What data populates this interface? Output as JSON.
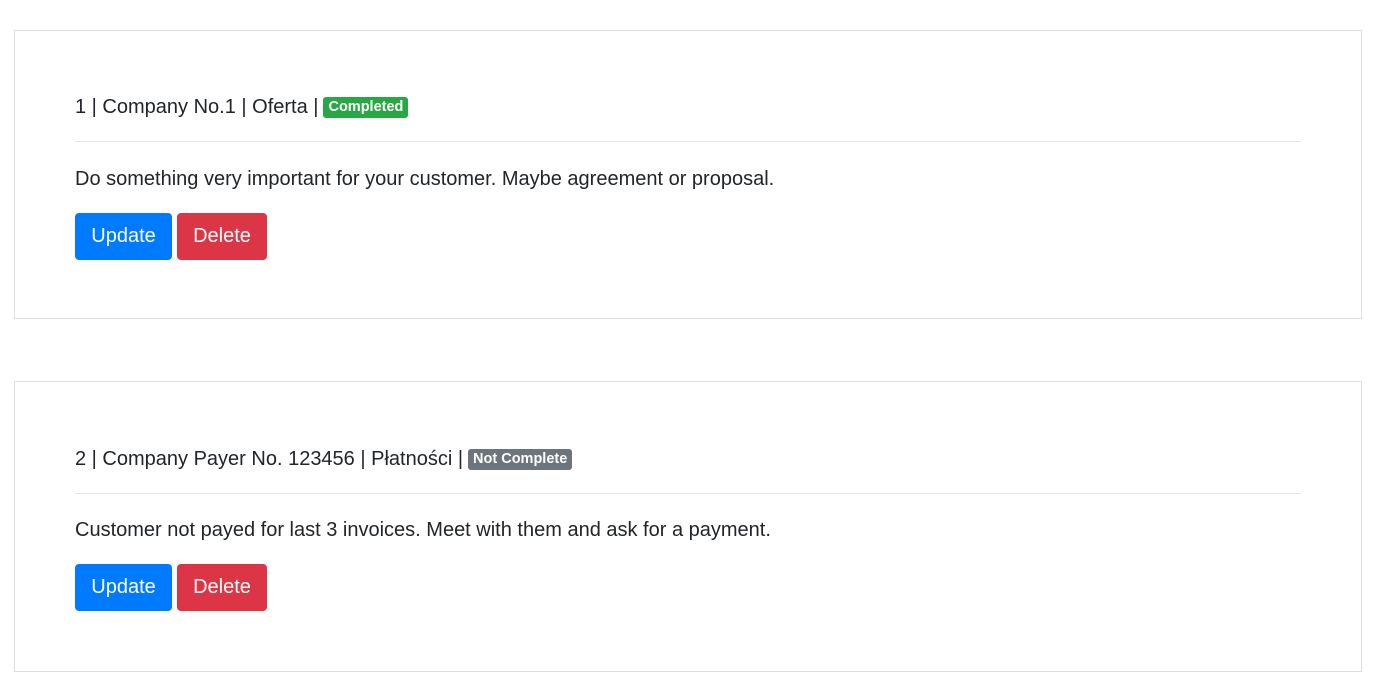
{
  "tasks": [
    {
      "title": "1 | Company No.1 | Oferta |",
      "status_label": "Completed",
      "status_color": "#28a745",
      "description": "Do something very important for your customer. Maybe agreement or proposal.",
      "update_label": "Update",
      "delete_label": "Delete"
    },
    {
      "title": "2 | Company Payer No. 123456 | Płatności |",
      "status_label": "Not Complete",
      "status_color": "#6c757d",
      "description": "Customer not payed for last 3 invoices. Meet with them and ask for a payment.",
      "update_label": "Update",
      "delete_label": "Delete"
    }
  ],
  "colors": {
    "update_button": "#007bff",
    "delete_button": "#dc3545"
  }
}
